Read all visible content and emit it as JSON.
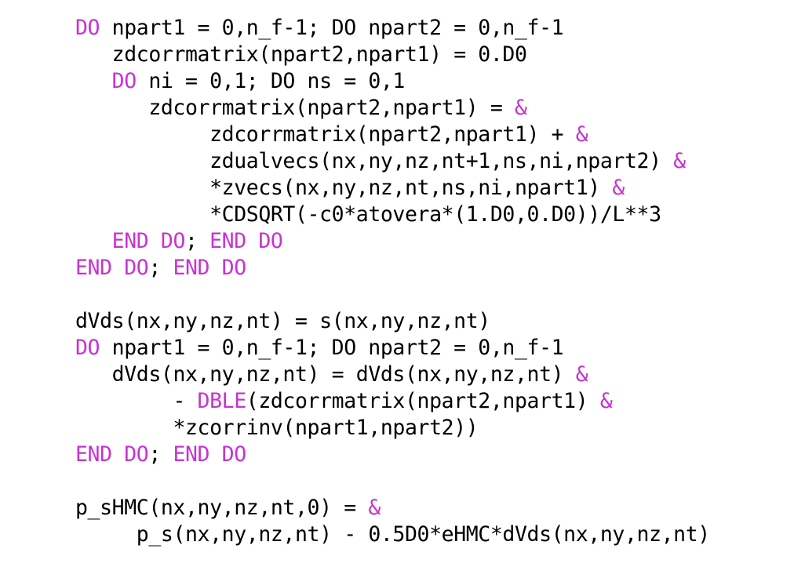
{
  "code": {
    "keyword_color": "#c832d2",
    "text_color": "#000000",
    "lines": [
      {
        "indent": 0,
        "tokens": [
          {
            "t": "DO",
            "k": 1
          },
          {
            "t": " npart1 = 0,n_f-1; DO npart2 = 0,n_f-1",
            "k": 0
          }
        ]
      },
      {
        "indent": 3,
        "tokens": [
          {
            "t": "zdcorrmatrix(npart2,npart1) = 0.D0",
            "k": 0
          }
        ]
      },
      {
        "indent": 3,
        "tokens": [
          {
            "t": "DO",
            "k": 1
          },
          {
            "t": " ni = 0,1; DO ns = 0,1",
            "k": 0
          }
        ]
      },
      {
        "indent": 6,
        "tokens": [
          {
            "t": "zdcorrmatrix(npart2,npart1) = ",
            "k": 0
          },
          {
            "t": "&",
            "k": 1
          }
        ]
      },
      {
        "indent": 11,
        "tokens": [
          {
            "t": "zdcorrmatrix(npart2,npart1) + ",
            "k": 0
          },
          {
            "t": "&",
            "k": 1
          }
        ]
      },
      {
        "indent": 11,
        "tokens": [
          {
            "t": "zdualvecs(nx,ny,nz,nt+1,ns,ni,npart2) ",
            "k": 0
          },
          {
            "t": "&",
            "k": 1
          }
        ]
      },
      {
        "indent": 11,
        "tokens": [
          {
            "t": "*zvecs(nx,ny,nz,nt,ns,ni,npart1) ",
            "k": 0
          },
          {
            "t": "&",
            "k": 1
          }
        ]
      },
      {
        "indent": 11,
        "tokens": [
          {
            "t": "*CDSQRT(-c0*atovera*(1.D0,0.D0))/L**3",
            "k": 0
          }
        ]
      },
      {
        "indent": 3,
        "tokens": [
          {
            "t": "END DO",
            "k": 1
          },
          {
            "t": "; ",
            "k": 0
          },
          {
            "t": "END DO",
            "k": 1
          }
        ]
      },
      {
        "indent": 0,
        "tokens": [
          {
            "t": "END DO",
            "k": 1
          },
          {
            "t": "; ",
            "k": 0
          },
          {
            "t": "END DO",
            "k": 1
          }
        ]
      },
      {
        "indent": 0,
        "tokens": []
      },
      {
        "indent": 0,
        "tokens": [
          {
            "t": "dVds(nx,ny,nz,nt) = s(nx,ny,nz,nt)",
            "k": 0
          }
        ]
      },
      {
        "indent": 0,
        "tokens": [
          {
            "t": "DO",
            "k": 1
          },
          {
            "t": " npart1 = 0,n_f-1; DO npart2 = 0,n_f-1",
            "k": 0
          }
        ]
      },
      {
        "indent": 3,
        "tokens": [
          {
            "t": "dVds(nx,ny,nz,nt) = dVds(nx,ny,nz,nt) ",
            "k": 0
          },
          {
            "t": "&",
            "k": 1
          }
        ]
      },
      {
        "indent": 8,
        "tokens": [
          {
            "t": "- ",
            "k": 0
          },
          {
            "t": "DBLE",
            "k": 1
          },
          {
            "t": "(zdcorrmatrix(npart2,npart1) ",
            "k": 0
          },
          {
            "t": "&",
            "k": 1
          }
        ]
      },
      {
        "indent": 8,
        "tokens": [
          {
            "t": "*zcorrinv(npart1,npart2))",
            "k": 0
          }
        ]
      },
      {
        "indent": 0,
        "tokens": [
          {
            "t": "END DO",
            "k": 1
          },
          {
            "t": "; ",
            "k": 0
          },
          {
            "t": "END DO",
            "k": 1
          }
        ]
      },
      {
        "indent": 0,
        "tokens": []
      },
      {
        "indent": 0,
        "tokens": [
          {
            "t": "p_sHMC(nx,ny,nz,nt,0) = ",
            "k": 0
          },
          {
            "t": "&",
            "k": 1
          }
        ]
      },
      {
        "indent": 5,
        "tokens": [
          {
            "t": "p_s(nx,ny,nz,nt) - 0.5D0*eHMC*dVds(nx,ny,nz,nt)",
            "k": 0
          }
        ]
      }
    ]
  }
}
